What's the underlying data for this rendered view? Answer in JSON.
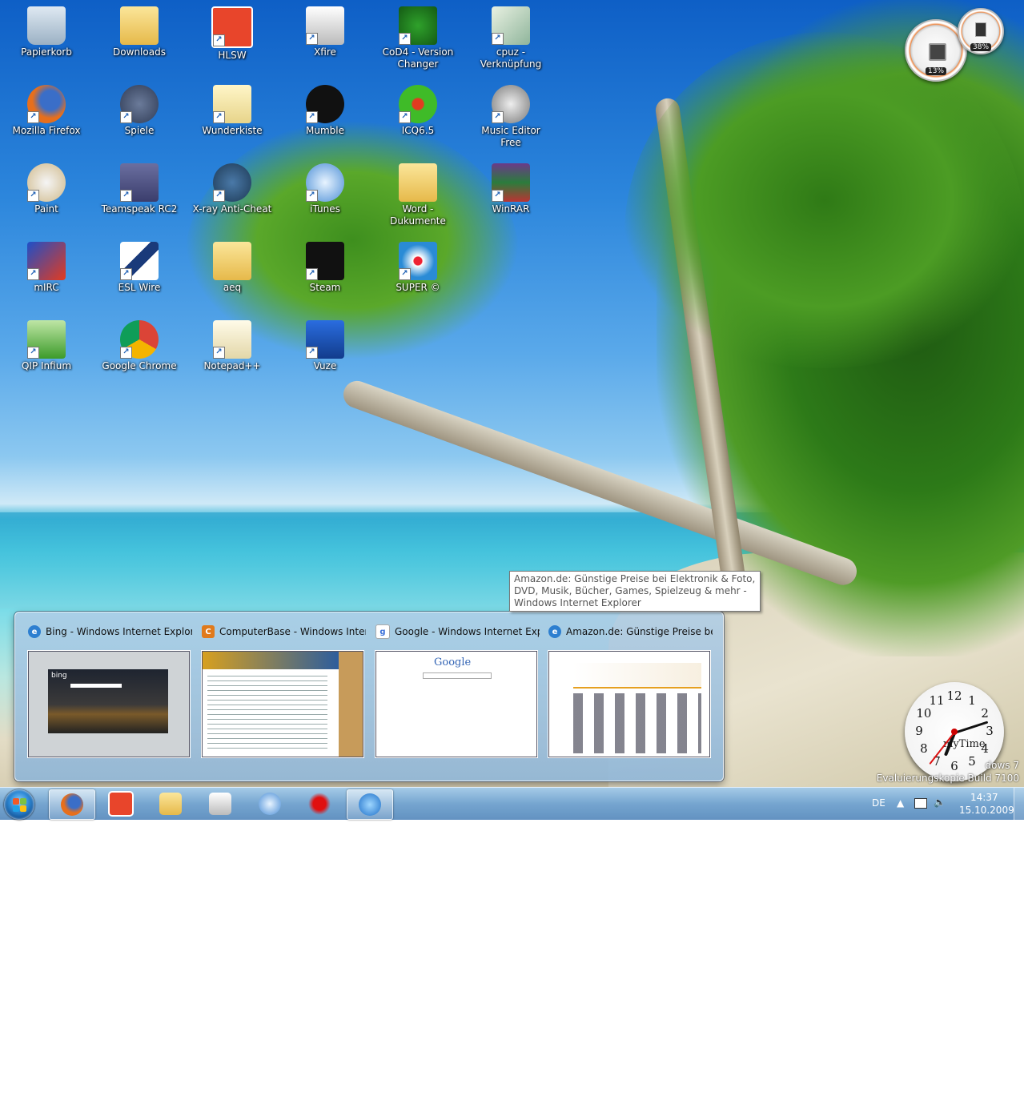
{
  "desktop": {
    "icons": [
      {
        "label": "Papierkorb",
        "icon": "recycle-bin-icon"
      },
      {
        "label": "Downloads",
        "icon": "folder-icon"
      },
      {
        "label": "HLSW",
        "icon": "hlsw-icon"
      },
      {
        "label": "Xfire",
        "icon": "xfire-icon"
      },
      {
        "label": "CoD4 - Version Changer",
        "icon": "cod4-icon"
      },
      {
        "label": "cpuz - Verknüpfung",
        "icon": "cpuz-icon"
      },
      {
        "label": "Mozilla Firefox",
        "icon": "firefox-icon"
      },
      {
        "label": "Spiele",
        "icon": "games-icon"
      },
      {
        "label": "Wunderkiste",
        "icon": "wunderkiste-icon"
      },
      {
        "label": "Mumble",
        "icon": "mumble-icon"
      },
      {
        "label": "ICQ6.5",
        "icon": "icq-icon"
      },
      {
        "label": "Music Editor Free",
        "icon": "headphones-icon"
      },
      {
        "label": "Paint",
        "icon": "paint-icon"
      },
      {
        "label": "Teamspeak RC2",
        "icon": "teamspeak-icon"
      },
      {
        "label": "X-ray Anti-Cheat",
        "icon": "xray-icon"
      },
      {
        "label": "iTunes",
        "icon": "itunes-icon"
      },
      {
        "label": "Word - Dukumente",
        "icon": "folder-icon"
      },
      {
        "label": "WinRAR",
        "icon": "winrar-icon"
      },
      {
        "label": "mIRC",
        "icon": "mirc-icon"
      },
      {
        "label": "ESL Wire",
        "icon": "eslwire-icon"
      },
      {
        "label": "aeq",
        "icon": "folder-icon"
      },
      {
        "label": "Steam",
        "icon": "steam-icon"
      },
      {
        "label": "SUPER ©",
        "icon": "super-icon"
      },
      {
        "label": "QIP Infium",
        "icon": "qip-icon"
      },
      {
        "label": "Google Chrome",
        "icon": "chrome-icon"
      },
      {
        "label": "Notepad++",
        "icon": "notepad-icon"
      },
      {
        "label": "Vuze",
        "icon": "vuze-icon"
      }
    ]
  },
  "gadgets": {
    "cpu_percent": "13%",
    "memory_percent": "38%",
    "clock_label": "myTime",
    "clock_numbers": [
      "12",
      "1",
      "2",
      "3",
      "4",
      "5",
      "6",
      "7",
      "8",
      "9",
      "10",
      "11"
    ]
  },
  "watermark": {
    "line1": "dows 7",
    "line2": "Evaluierungskopie Build 7100"
  },
  "tooltip": {
    "text": "Amazon.de: Günstige Preise bei Elektronik & Foto, DVD, Musik, Bücher, Games, Spielzeug & mehr - Windows Internet Explorer"
  },
  "previews": [
    {
      "title": "Bing - Windows Internet Explorer",
      "icon": "ie-icon"
    },
    {
      "title": "ComputerBase - Windows Inter...",
      "icon": "computerbase-icon"
    },
    {
      "title": "Google - Windows Internet Expl...",
      "icon": "google-icon"
    },
    {
      "title": "Amazon.de: Günstige Preise bei ...",
      "icon": "ie-icon"
    }
  ],
  "thumb_text": {
    "google": "Google",
    "bing": "bing"
  },
  "taskbar": {
    "apps": [
      {
        "icon": "firefox-icon",
        "active": true
      },
      {
        "icon": "hlsw-icon",
        "active": false
      },
      {
        "icon": "explorer-icon",
        "active": false
      },
      {
        "icon": "xfire-icon",
        "active": false
      },
      {
        "icon": "itunes-icon",
        "active": false
      },
      {
        "icon": "splat-icon",
        "active": false
      },
      {
        "icon": "ie-icon",
        "active": true
      }
    ],
    "language": "DE",
    "time": "14:37",
    "date": "15.10.2009"
  }
}
